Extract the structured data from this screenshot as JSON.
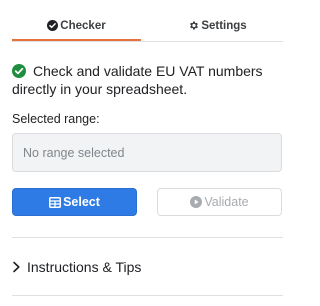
{
  "tabs": {
    "checker": {
      "label": "Checker",
      "icon": "check-circle-icon",
      "active": true
    },
    "settings": {
      "label": "Settings",
      "icon": "gear-icon",
      "active": false
    }
  },
  "intro": {
    "icon": "check-circle-icon",
    "text": "Check and validate EU VAT numbers directly in your spreadsheet."
  },
  "range": {
    "label": "Selected range:",
    "value": "",
    "placeholder": "No range selected"
  },
  "buttons": {
    "select": {
      "label": "Select",
      "icon": "table-icon"
    },
    "validate": {
      "label": "Validate",
      "icon": "play-circle-icon",
      "disabled": true
    }
  },
  "accordion": {
    "label": "Instructions & Tips",
    "icon": "chevron-right-icon",
    "expanded": false
  },
  "colors": {
    "accent": "#e8703a",
    "primary": "#2f7be5",
    "success": "#1e8e3e"
  }
}
